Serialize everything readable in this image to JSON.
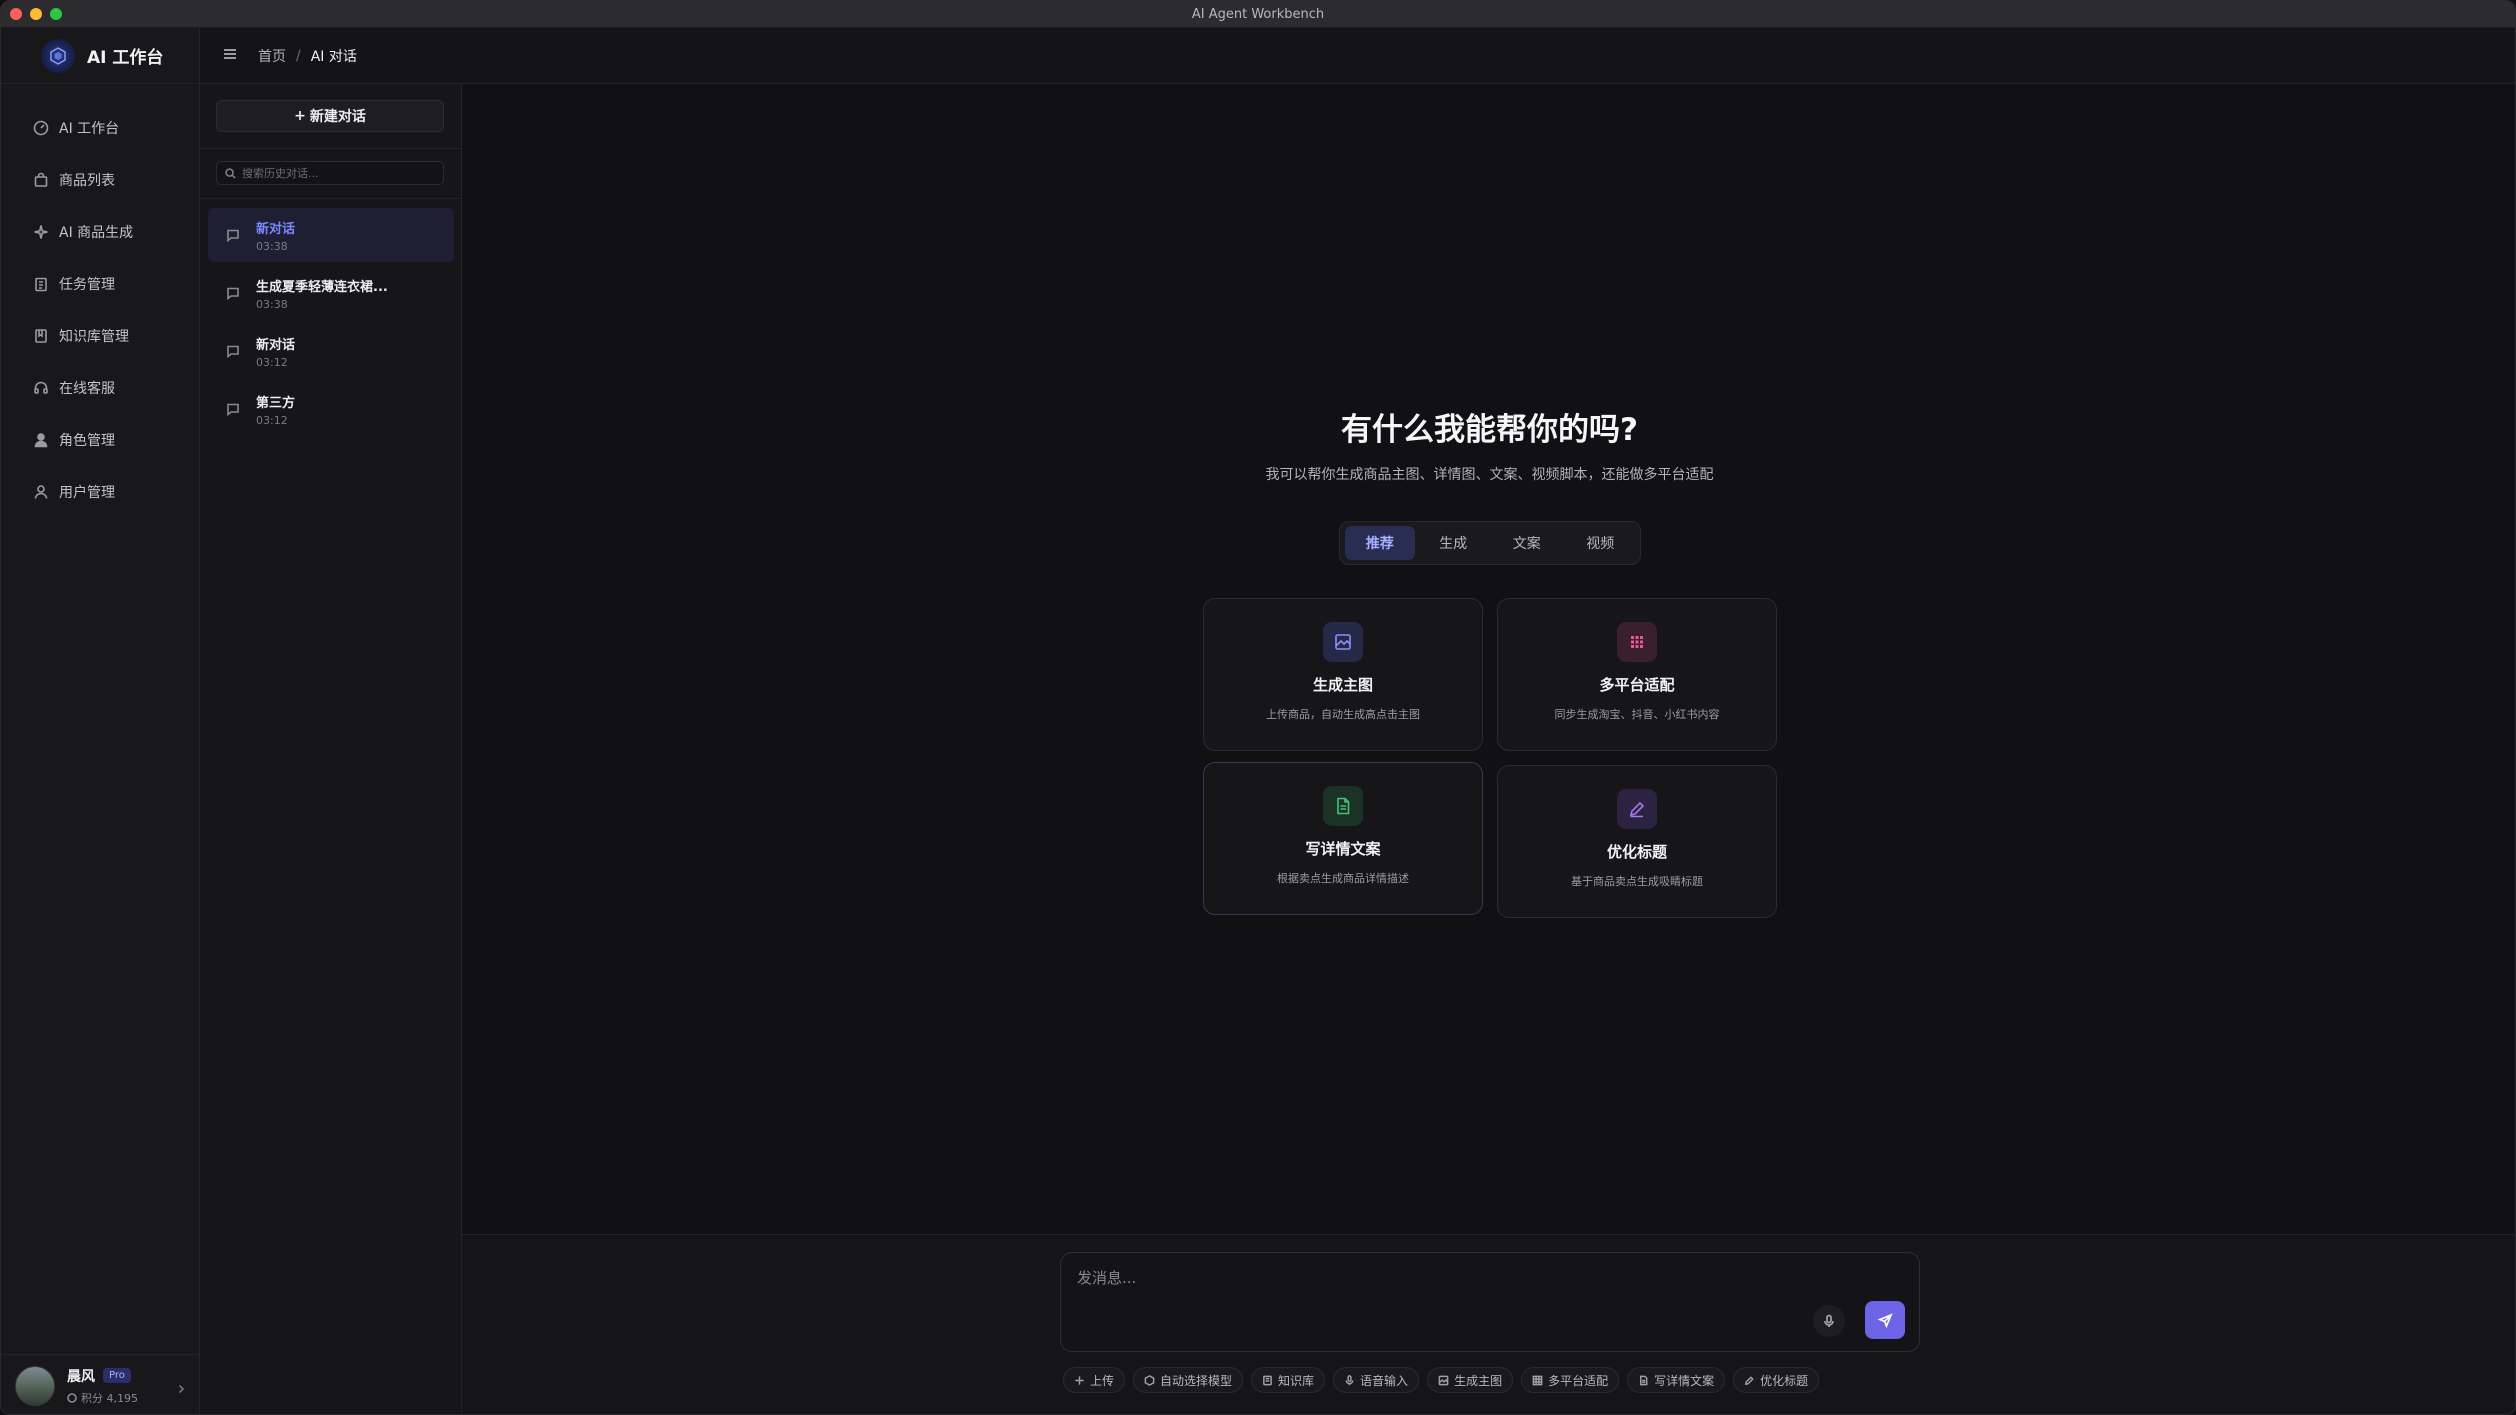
{
  "window": {
    "title": "AI Agent Workbench"
  },
  "brand": {
    "name": "AI 工作台"
  },
  "sidebar": {
    "items": [
      {
        "label": "AI 工作台",
        "icon": "dashboard-icon"
      },
      {
        "label": "商品列表",
        "icon": "shopping-bag-icon"
      },
      {
        "label": "AI 商品生成",
        "icon": "sparkles-icon"
      },
      {
        "label": "任务管理",
        "icon": "clipboard-icon"
      },
      {
        "label": "知识库管理",
        "icon": "book-icon"
      },
      {
        "label": "在线客服",
        "icon": "headset-icon"
      },
      {
        "label": "角色管理",
        "icon": "user-group-icon"
      },
      {
        "label": "用户管理",
        "icon": "user-icon"
      }
    ]
  },
  "user": {
    "name": "晨风",
    "badge": "Pro",
    "credits": "积分 4,195"
  },
  "header": {
    "breadcrumb_home": "首页",
    "breadcrumb_sep": "/",
    "breadcrumb_current": "AI 对话"
  },
  "history": {
    "new_chat_label": "新建对话",
    "search_placeholder": "搜索历史对话...",
    "conversations": [
      {
        "title": "新对话",
        "time": "03:38",
        "active": true
      },
      {
        "title": "生成夏季轻薄连衣裙...",
        "time": "03:38",
        "active": false
      },
      {
        "title": "新对话",
        "time": "03:12",
        "active": false
      },
      {
        "title": "第三方",
        "time": "03:12",
        "active": false
      }
    ]
  },
  "main": {
    "title": "有什么我能帮你的吗?",
    "subtitle": "我可以帮你生成商品主图、详情图、文案、视频脚本，还能做多平台适配",
    "tabs": [
      {
        "label": "推荐",
        "active": true
      },
      {
        "label": "生成",
        "active": false
      },
      {
        "label": "文案",
        "active": false
      },
      {
        "label": "视频",
        "active": false
      }
    ],
    "cards": [
      {
        "title": "生成主图",
        "desc": "上传商品，自动生成高点击主图",
        "icon": "image-icon",
        "color": "#8a90ff",
        "bg": "#252846"
      },
      {
        "title": "多平台适配",
        "desc": "同步生成淘宝、抖音、小红书内容",
        "icon": "grid-icon",
        "color": "#f0559a",
        "bg": "#3a1f2c"
      },
      {
        "title": "写详情文案",
        "desc": "根据卖点生成商品详情描述",
        "icon": "document-icon",
        "color": "#46c27a",
        "bg": "#1b3326"
      },
      {
        "title": "优化标题",
        "desc": "基于商品卖点生成吸睛标题",
        "icon": "pen-icon",
        "color": "#a678f0",
        "bg": "#2c2342"
      }
    ]
  },
  "composer": {
    "placeholder": "发消息...",
    "tools": [
      {
        "label": "上传",
        "icon": "plus-icon"
      },
      {
        "label": "自动选择模型",
        "icon": "cube-icon"
      },
      {
        "label": "知识库",
        "icon": "book-icon"
      },
      {
        "label": "语音输入",
        "icon": "mic-icon"
      },
      {
        "label": "生成主图",
        "icon": "image-icon"
      },
      {
        "label": "多平台适配",
        "icon": "grid-icon"
      },
      {
        "label": "写详情文案",
        "icon": "document-icon"
      },
      {
        "label": "优化标题",
        "icon": "pen-icon"
      }
    ]
  }
}
